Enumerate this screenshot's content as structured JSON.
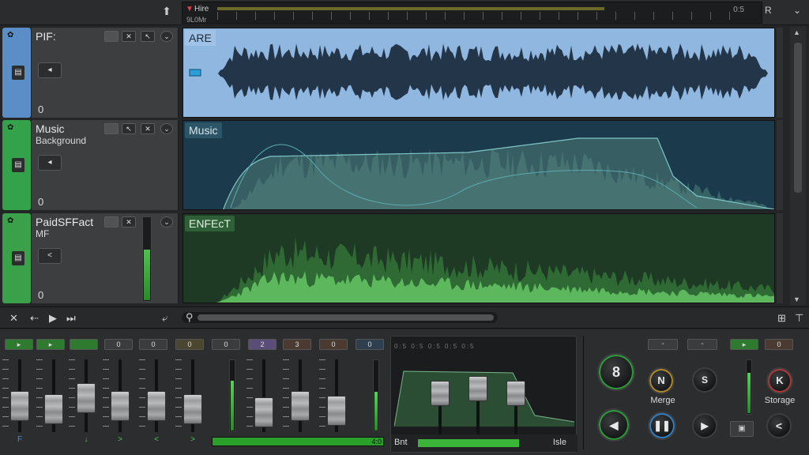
{
  "topbar": {
    "marker_label": "Hire",
    "sub_label": "9L0Mr",
    "time_label": "0:5",
    "r_label": "R"
  },
  "tracks": [
    {
      "name": "PIF:",
      "sub": "",
      "level": "0",
      "lane_label": "ARE",
      "mini_button": "◂",
      "color": "#5b8dc7",
      "lane_bg": "#8fb7e0",
      "label_bg": "#9fc2e6",
      "label_color": "#1c2a3a"
    },
    {
      "name": "Music",
      "sub": "Background",
      "level": "0",
      "lane_label": "Music",
      "mini_button": "◂",
      "color": "#34a24b",
      "lane_bg": "#1b3b4c",
      "label_bg": "#2c5568",
      "label_color": "#d9e4ea"
    },
    {
      "name": "PaidSFFact",
      "sub": "MF",
      "level": "0",
      "lane_label": "ENFEcT",
      "mini_button": "<",
      "color": "#3aa14a",
      "lane_bg": "#1f3a24",
      "label_bg": "#2f5f37",
      "label_color": "#e0f0e0"
    }
  ],
  "mixer": {
    "buttons": [
      "0",
      "0",
      "0",
      "0",
      "2",
      "3",
      "0",
      "0"
    ],
    "button_colors": [
      "#3a3c3e",
      "#3a3c3e",
      "#4a4630",
      "#3a3c3e",
      "#5a4e78",
      "#4a3a32",
      "#4a3a32",
      "#2e4050"
    ],
    "channel_labels": [
      "F",
      "↓",
      ">",
      "<",
      ">"
    ],
    "bottom_meter_value": "4:0",
    "eq_left": "Bnt",
    "eq_right": "Isle",
    "eq_ticks": "0:5  0:5  0:5  0:5  0:5",
    "right_buttons": [
      "-",
      "-",
      "0"
    ],
    "knobs": {
      "main": "8",
      "n": "N",
      "s": "S",
      "k": "K",
      "merge_label": "Merge",
      "storage_label": "Storage"
    }
  }
}
